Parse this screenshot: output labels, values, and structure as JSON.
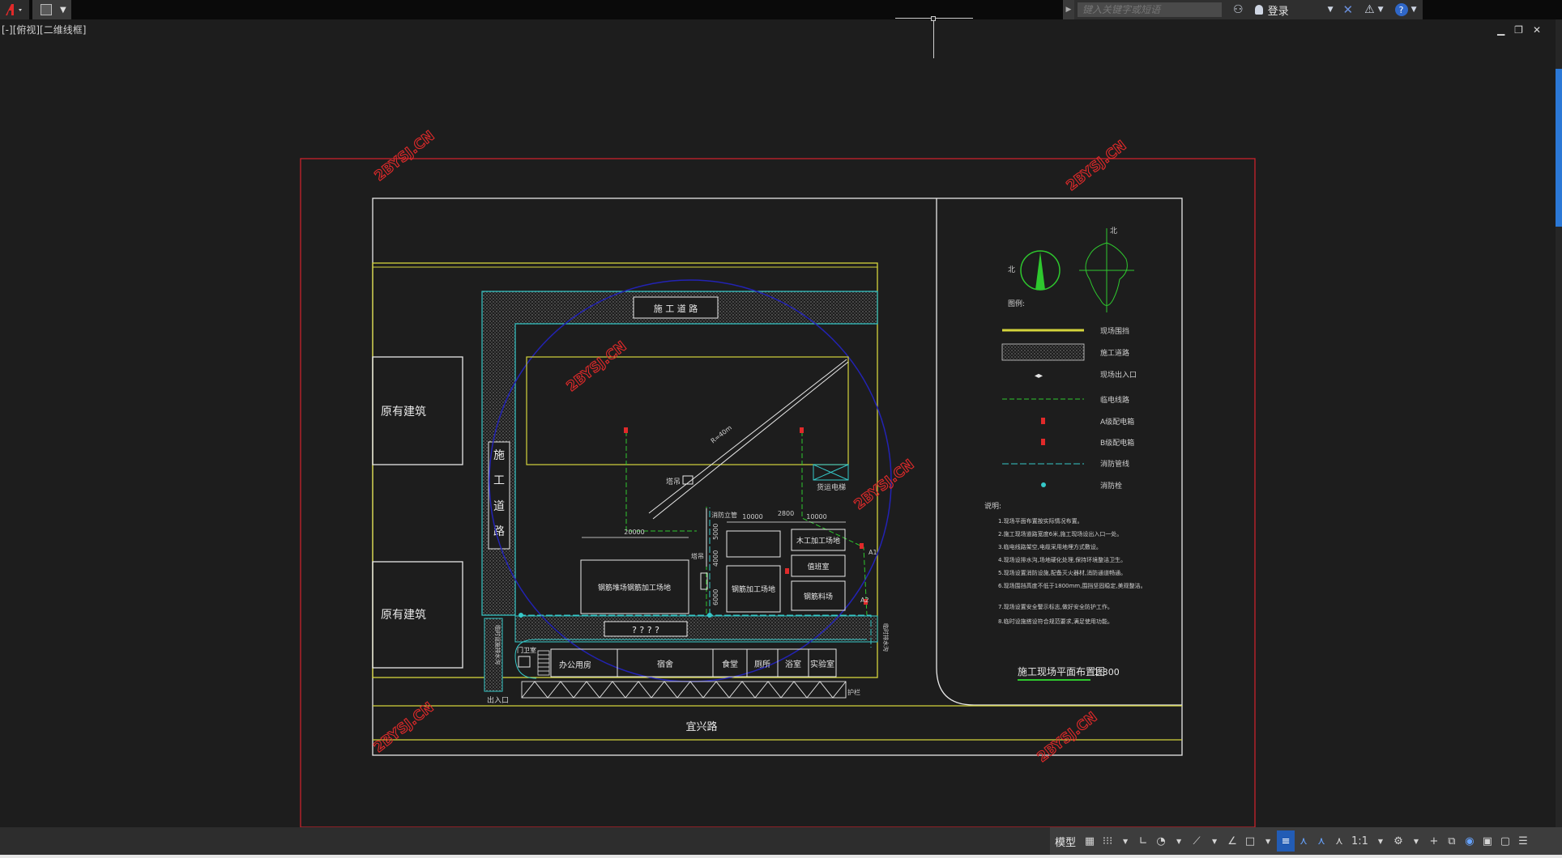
{
  "topbar": {
    "search_placeholder": "键入关键字或短语",
    "login_label": "登录",
    "help_label": "?"
  },
  "viewport": {
    "label": "[-][俯视][二维线框]"
  },
  "drawing": {
    "watermark": "2BYSJ.CN",
    "construction_road": "施 工 道 路",
    "construction_road_vertical": [
      "施",
      "工",
      "道",
      "路"
    ],
    "existing_building_1": "原有建筑",
    "existing_building_2": "原有建筑",
    "road_bottom": "宜兴路",
    "crane_label": "塔吊",
    "crane_radius": "R=40m",
    "hoist_label": "货运电梯",
    "dims": [
      "10000",
      "2800",
      "10000",
      "20000",
      "5000",
      "4000",
      "6000"
    ],
    "fire_label": "消防立管",
    "yard_label": "钢筋堆场钢筋加工场地",
    "rebar_processing": "钢筋加工场地",
    "woodwork": "木工加工场地",
    "duty_room": "值班室",
    "rebar_yard": "钢筋料场",
    "placeholder_text": "? ? ? ?",
    "office": "办公用房",
    "dorm": "宿舍",
    "canteen": "食堂",
    "toilet": "厕所",
    "bath": "浴室",
    "lab": "实验室",
    "guard": "门卫室",
    "entrance": "出入口",
    "fence_note": "护栏",
    "side_note": "临时排水沟",
    "left_vertical": "临时设施排水沟",
    "a1": "A1",
    "a2": "A2",
    "legend": {
      "north": "北",
      "title": "图例:",
      "items": [
        "现场围挡",
        "施工道路",
        "现场出入口",
        "临电线路",
        "A级配电箱",
        "B级配电箱",
        "消防管线",
        "消防栓"
      ]
    },
    "notes_title": "说明:",
    "notes": [
      "1.现场平面布置按实际情况布置。",
      "2.施工现场道路宽度6米,施工现场设出入口一处。",
      "3.临电线路架空,电缆采用地埋方式敷设。",
      "4.现场设排水沟,场地硬化处理,保持环境整洁卫生。",
      "5.现场设置消防设施,配备灭火器材,消防通道畅通。",
      "6.现场围挡高度不低于1800mm,围挡坚固稳定,美观整洁。",
      "7.现场设置安全警示标志,做好安全防护工作。",
      "8.临时设施搭设符合规范要求,满足使用功能。"
    ],
    "plan_title": "施工现场平面布置图",
    "plan_scale": "1:300"
  },
  "statusbar": {
    "model_label": "模型",
    "scale_label": "1:1"
  },
  "colors": {
    "frame_red": "#c8232c",
    "sheet_white": "#e8e8e8",
    "yellow": "#d4d43c",
    "cyan": "#35c8c8",
    "blue": "#2323b4",
    "green": "#2ec82e"
  }
}
